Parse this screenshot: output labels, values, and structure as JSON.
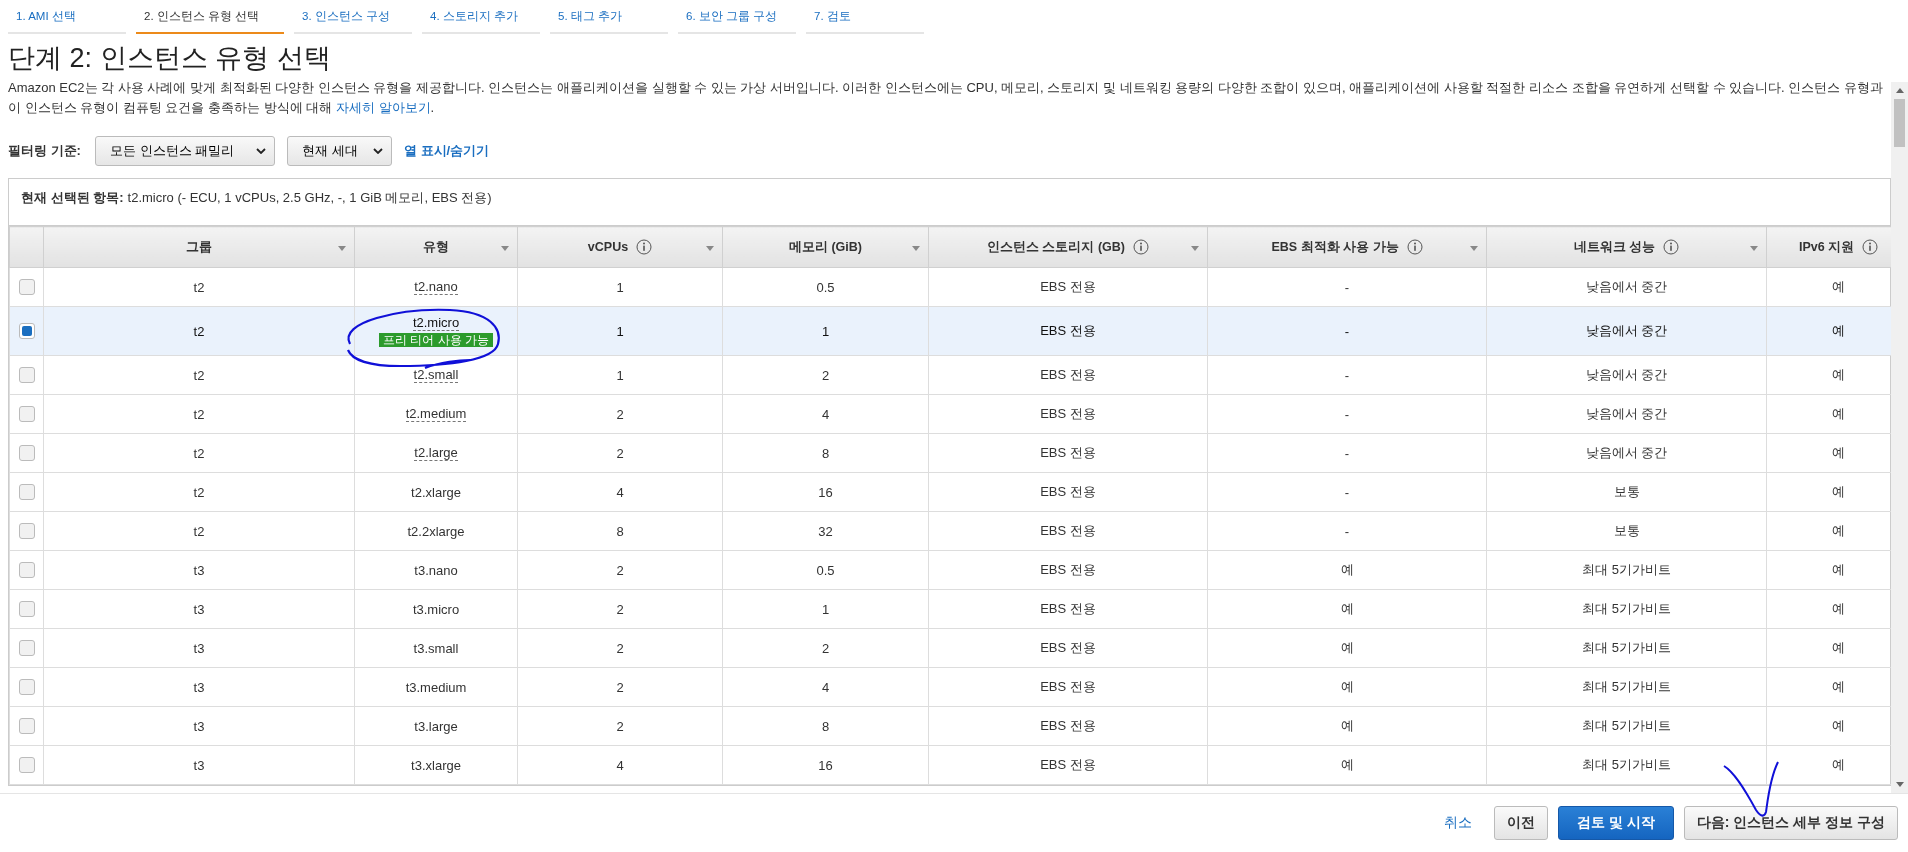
{
  "wizard_steps": [
    {
      "label": "1. AMI 선택",
      "selected": false
    },
    {
      "label": "2. 인스턴스 유형 선택",
      "selected": true
    },
    {
      "label": "3. 인스턴스 구성",
      "selected": false
    },
    {
      "label": "4. 스토리지 추가",
      "selected": false
    },
    {
      "label": "5. 태그 추가",
      "selected": false
    },
    {
      "label": "6. 보안 그룹 구성",
      "selected": false
    },
    {
      "label": "7. 검토",
      "selected": false
    }
  ],
  "title": "단계 2: 인스턴스 유형 선택",
  "description": "Amazon EC2는 각 사용 사례에 맞게 최적화된 다양한 인스턴스 유형을 제공합니다. 인스턴스는 애플리케이션을 실행할 수 있는 가상 서버입니다. 이러한 인스턴스에는 CPU, 메모리, 스토리지 및 네트워킹 용량의 다양한 조합이 있으며, 애플리케이션에 사용할 적절한 리소스 조합을 유연하게 선택할 수 있습니다. 인스턴스 유형과 이 인스턴스 유형이 컴퓨팅 요건을 충족하는 방식에 대해",
  "learn_more_link": "자세히 알아보기",
  "description_end": ".",
  "filter": {
    "label": "필터링 기준:",
    "family": "모든 인스턴스 패밀리",
    "generation": "현재 세대",
    "columns_link": "열 표시/숨기기"
  },
  "current_selection": {
    "label": "현재 선택된 항목:",
    "value": "t2.micro (- ECU, 1 vCPUs, 2.5 GHz, -, 1 GiB 메모리, EBS 전용)"
  },
  "table": {
    "columns": [
      {
        "label": "그룹",
        "info": false
      },
      {
        "label": "유형",
        "info": false
      },
      {
        "label": "vCPUs",
        "info": true
      },
      {
        "label": "메모리 (GiB)",
        "info": false
      },
      {
        "label": "인스턴스 스토리지 (GB)",
        "info": true
      },
      {
        "label": "EBS 최적화 사용 가능",
        "info": true
      },
      {
        "label": "네트워크 성능",
        "info": true
      },
      {
        "label": "IPv6 지원",
        "info": true
      }
    ],
    "rows": [
      {
        "selected": false,
        "group": "t2",
        "type": "t2.nano",
        "hint": true,
        "vcpus": "1",
        "memory": "0.5",
        "storage": "EBS 전용",
        "ebs": "-",
        "network": "낮음에서 중간",
        "ipv6": "예"
      },
      {
        "selected": true,
        "group": "t2",
        "type": "t2.micro",
        "hint": true,
        "badge": "프리 티어 사용 가능",
        "vcpus": "1",
        "memory": "1",
        "storage": "EBS 전용",
        "ebs": "-",
        "network": "낮음에서 중간",
        "ipv6": "예"
      },
      {
        "selected": false,
        "group": "t2",
        "type": "t2.small",
        "hint": true,
        "vcpus": "1",
        "memory": "2",
        "storage": "EBS 전용",
        "ebs": "-",
        "network": "낮음에서 중간",
        "ipv6": "예"
      },
      {
        "selected": false,
        "group": "t2",
        "type": "t2.medium",
        "hint": true,
        "vcpus": "2",
        "memory": "4",
        "storage": "EBS 전용",
        "ebs": "-",
        "network": "낮음에서 중간",
        "ipv6": "예"
      },
      {
        "selected": false,
        "group": "t2",
        "type": "t2.large",
        "hint": true,
        "vcpus": "2",
        "memory": "8",
        "storage": "EBS 전용",
        "ebs": "-",
        "network": "낮음에서 중간",
        "ipv6": "예"
      },
      {
        "selected": false,
        "group": "t2",
        "type": "t2.xlarge",
        "hint": false,
        "vcpus": "4",
        "memory": "16",
        "storage": "EBS 전용",
        "ebs": "-",
        "network": "보통",
        "ipv6": "예"
      },
      {
        "selected": false,
        "group": "t2",
        "type": "t2.2xlarge",
        "hint": false,
        "vcpus": "8",
        "memory": "32",
        "storage": "EBS 전용",
        "ebs": "-",
        "network": "보통",
        "ipv6": "예"
      },
      {
        "selected": false,
        "group": "t3",
        "type": "t3.nano",
        "hint": false,
        "vcpus": "2",
        "memory": "0.5",
        "storage": "EBS 전용",
        "ebs": "예",
        "network": "최대 5기가비트",
        "ipv6": "예"
      },
      {
        "selected": false,
        "group": "t3",
        "type": "t3.micro",
        "hint": false,
        "vcpus": "2",
        "memory": "1",
        "storage": "EBS 전용",
        "ebs": "예",
        "network": "최대 5기가비트",
        "ipv6": "예"
      },
      {
        "selected": false,
        "group": "t3",
        "type": "t3.small",
        "hint": false,
        "vcpus": "2",
        "memory": "2",
        "storage": "EBS 전용",
        "ebs": "예",
        "network": "최대 5기가비트",
        "ipv6": "예"
      },
      {
        "selected": false,
        "group": "t3",
        "type": "t3.medium",
        "hint": false,
        "vcpus": "2",
        "memory": "4",
        "storage": "EBS 전용",
        "ebs": "예",
        "network": "최대 5기가비트",
        "ipv6": "예"
      },
      {
        "selected": false,
        "group": "t3",
        "type": "t3.large",
        "hint": false,
        "vcpus": "2",
        "memory": "8",
        "storage": "EBS 전용",
        "ebs": "예",
        "network": "최대 5기가비트",
        "ipv6": "예"
      },
      {
        "selected": false,
        "group": "t3",
        "type": "t3.xlarge",
        "hint": false,
        "vcpus": "4",
        "memory": "16",
        "storage": "EBS 전용",
        "ebs": "예",
        "network": "최대 5기가비트",
        "ipv6": "예"
      }
    ]
  },
  "footer": {
    "cancel": "취소",
    "previous": "이전",
    "review_launch": "검토 및 시작",
    "next": "다음: 인스턴스 세부 정보 구성"
  }
}
